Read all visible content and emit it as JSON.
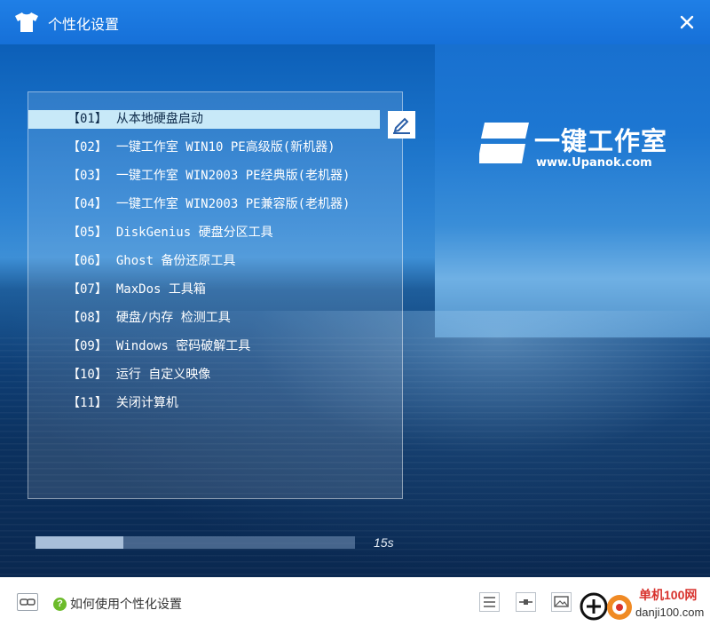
{
  "window": {
    "title": "个性化设置",
    "title_icon": "tshirt-icon",
    "close_icon": "close-icon"
  },
  "menu": {
    "items": [
      {
        "num": "【01】",
        "label": "从本地硬盘启动",
        "selected": true
      },
      {
        "num": "【02】",
        "label": "一键工作室 WIN10 PE高级版(新机器)"
      },
      {
        "num": "【03】",
        "label": "一键工作室 WIN2003 PE经典版(老机器)"
      },
      {
        "num": "【04】",
        "label": "一键工作室 WIN2003 PE兼容版(老机器)"
      },
      {
        "num": "【05】",
        "label": "DiskGenius 硬盘分区工具"
      },
      {
        "num": "【06】",
        "label": "Ghost 备份还原工具"
      },
      {
        "num": "【07】",
        "label": "MaxDos 工具箱"
      },
      {
        "num": "【08】",
        "label": "硬盘/内存 检测工具"
      },
      {
        "num": "【09】",
        "label": "Windows 密码破解工具"
      },
      {
        "num": "【10】",
        "label": "运行 自定义映像"
      },
      {
        "num": "【11】",
        "label": "关闭计算机"
      }
    ],
    "edit_icon": "edit-pen-icon"
  },
  "logo": {
    "text": "一键工作室",
    "url": "www.Upanok.com"
  },
  "progress": {
    "value_fraction": 0.275,
    "countdown": "15s"
  },
  "footer": {
    "link_icon": "link-icon",
    "help_icon_glyph": "?",
    "help_text": "如何使用个性化设置",
    "toolbar_icons": [
      "menu-lines-icon",
      "slider-icon",
      "image-icon",
      "add-icon"
    ]
  },
  "watermark": {
    "text": "单机100网",
    "url": "danji100.com"
  },
  "colors": {
    "titlebar": "#1670d8",
    "selected_row": "#c8e9f8",
    "help_green": "#6cbb2a"
  }
}
